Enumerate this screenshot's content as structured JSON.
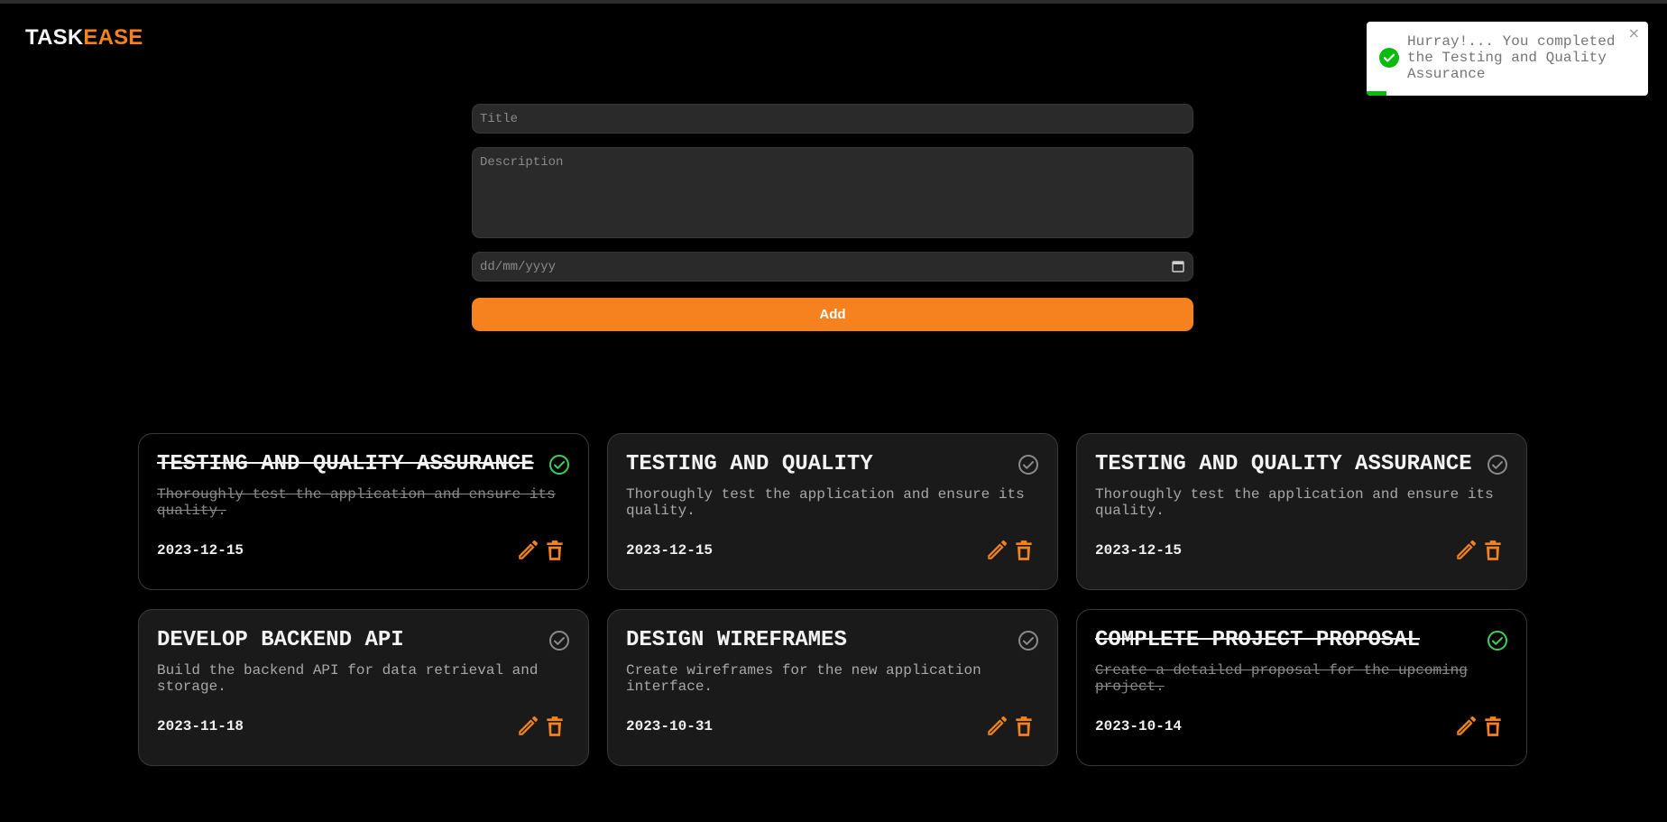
{
  "brand": {
    "part1": "TASK",
    "part2": "EASE"
  },
  "colors": {
    "accent": "#f5821f",
    "check_done": "#3fcf5a",
    "check_todo": "#8a8a8a",
    "success": "#07bc0c"
  },
  "form": {
    "title_placeholder": "Title",
    "description_placeholder": "Description",
    "date_placeholder": "dd/mm/yyyy",
    "add_label": "Add",
    "calendar_icon": "calendar-icon"
  },
  "tasks": [
    {
      "title": "TESTING AND QUALITY ASSURANCE",
      "description": "Thoroughly test the application and ensure its quality.",
      "date": "2023-12-15",
      "completed": true
    },
    {
      "title": "TESTING AND QUALITY",
      "description": "Thoroughly test the application and ensure its quality.",
      "date": "2023-12-15",
      "completed": false
    },
    {
      "title": "TESTING AND QUALITY ASSURANCE",
      "description": "Thoroughly test the application and ensure its quality.",
      "date": "2023-12-15",
      "completed": false
    },
    {
      "title": "DEVELOP BACKEND API",
      "description": "Build the backend API for data retrieval and storage.",
      "date": "2023-11-18",
      "completed": false
    },
    {
      "title": "DESIGN WIREFRAMES",
      "description": "Create wireframes for the new application interface.",
      "date": "2023-10-31",
      "completed": false
    },
    {
      "title": "COMPLETE PROJECT PROPOSAL",
      "description": "Create a detailed proposal for the upcoming project.",
      "date": "2023-10-14",
      "completed": true
    }
  ],
  "task_icons": {
    "check": "check-circle-icon",
    "edit": "pencil-icon",
    "delete": "trash-icon"
  },
  "toast": {
    "message": "Hurray!... You completed the Testing and Quality Assurance",
    "close": "×",
    "icon": "success-check-icon",
    "progress": 0.07
  }
}
